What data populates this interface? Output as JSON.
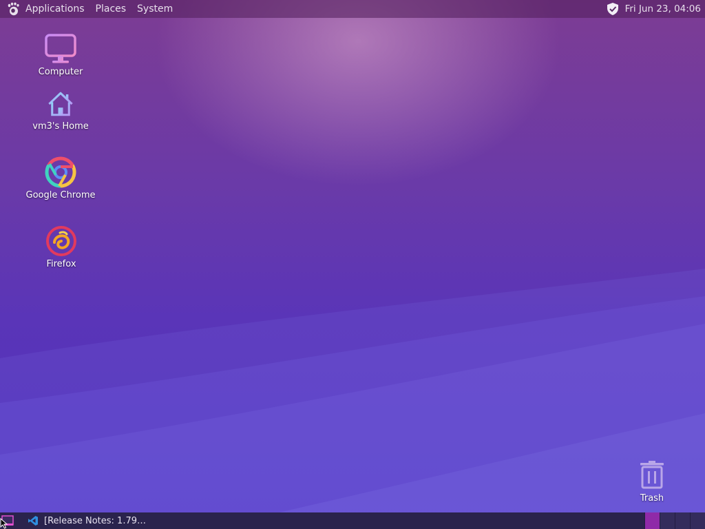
{
  "top_panel": {
    "menus": [
      "Applications",
      "Places",
      "System"
    ],
    "logo_icon": "gnome-foot-icon",
    "security_icon": "shield-check-icon",
    "clock": "Fri Jun 23, 04:06"
  },
  "desktop": {
    "icons": [
      {
        "label": "Computer",
        "icon": "monitor-icon"
      },
      {
        "label": "vm3's Home",
        "icon": "home-icon"
      },
      {
        "label": "Google Chrome",
        "icon": "chrome-icon"
      },
      {
        "label": "Firefox",
        "icon": "firefox-icon"
      },
      {
        "label": "Trash",
        "icon": "trash-icon"
      }
    ]
  },
  "bottom_panel": {
    "show_desktop_icon": "show-desktop-icon",
    "tasks": [
      {
        "label": "[Release Notes: 1.79…",
        "icon": "vscode-icon"
      }
    ],
    "workspaces": [
      {
        "active": true
      },
      {
        "active": false
      },
      {
        "active": false
      },
      {
        "active": false
      }
    ]
  },
  "colors": {
    "accent": "#8f2aa8",
    "panel_bottom": "#2a234d"
  }
}
